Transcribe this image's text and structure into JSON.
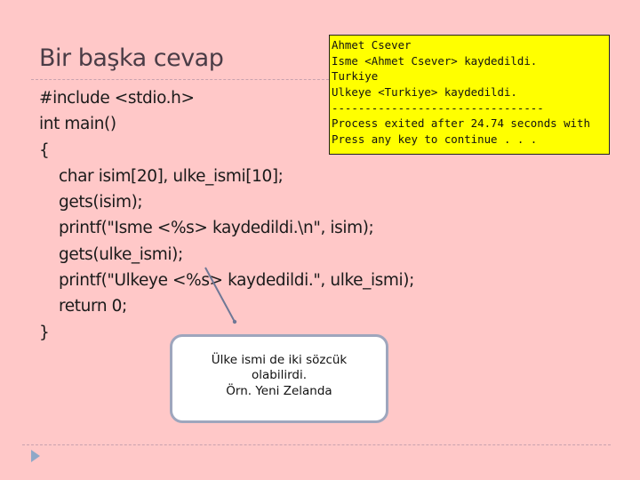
{
  "slide": {
    "title": "Bir başka cevap",
    "colors": {
      "background": "#ffc8c8",
      "console_background": "#ffff00",
      "callout_border": "#9ea6bd",
      "bullet_arrow": "#8fa8c8"
    }
  },
  "code": {
    "lines": [
      "#include <stdio.h>",
      "int main()",
      "{",
      "char isim[20], ulke_ismi[10];",
      "gets(isim);",
      "printf(\"Isme <%s> kaydedildi.\\n\", isim);",
      "gets(ulke_ismi);",
      "printf(\"Ulkeye <%s> kaydedildi.\", ulke_ismi);",
      "return 0;",
      "}"
    ]
  },
  "console": {
    "lines": [
      "Ahmet Csever",
      "Isme <Ahmet Csever> kaydedildi.",
      "Turkiye",
      "Ulkeye <Turkiye> kaydedildi.",
      "--------------------------------",
      "Process exited after 24.74 seconds with",
      "Press any key to continue . . ."
    ]
  },
  "callout": {
    "lines": [
      "Ülke ismi de iki sözcük",
      "olabilirdi.",
      "Örn. Yeni Zelanda"
    ]
  },
  "icons": {
    "bullet": "right-triangle-arrow-icon"
  }
}
